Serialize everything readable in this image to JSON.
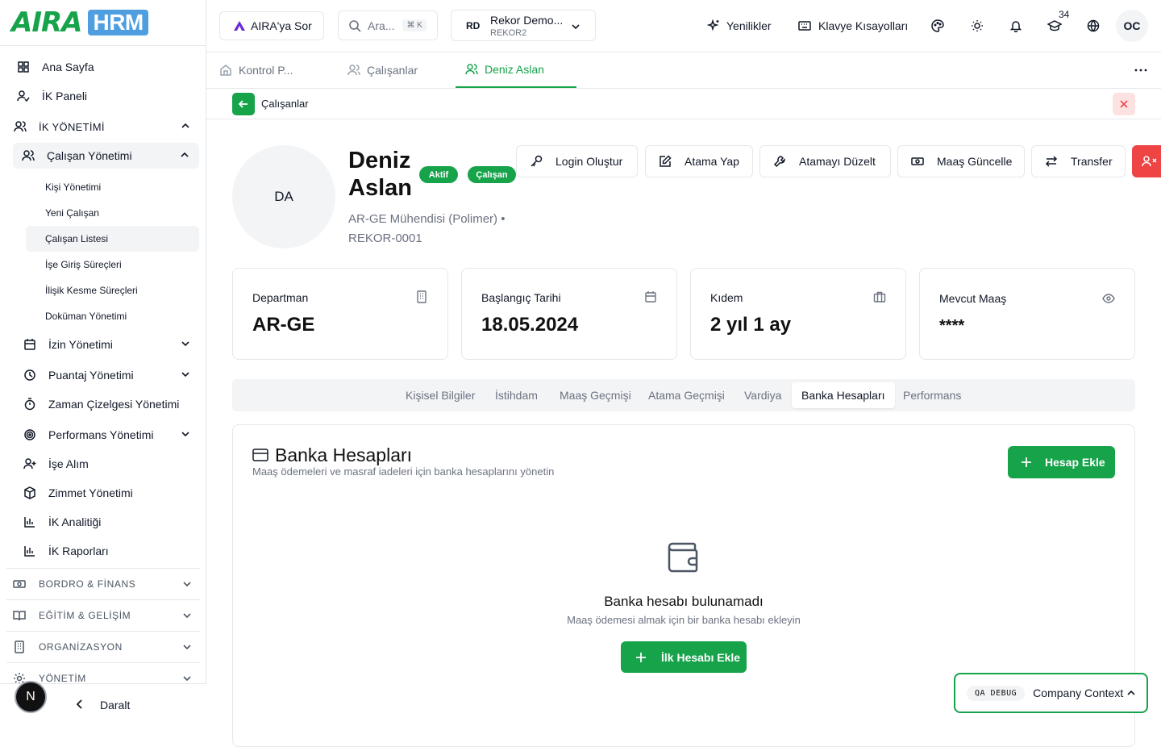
{
  "brand": {
    "logo_text": "AIRA",
    "logo_badge": "HRM",
    "accent": "#16a34a",
    "danger": "#ef4444"
  },
  "sidebar": {
    "items": [
      {
        "label": "Ana Sayfa",
        "icon": "grid-icon"
      },
      {
        "label": "İK Paneli",
        "icon": "user-check-icon"
      }
    ],
    "ik_section": {
      "label": "İK YÖNETİMİ"
    },
    "calisan_yonetimi": {
      "label": "Çalışan Yönetimi",
      "children": [
        "Kişi Yönetimi",
        "Yeni Çalışan",
        "Çalışan Listesi",
        "İşe Giriş Süreçleri",
        "İlişik Kesme Süreçleri",
        "Doküman Yönetimi"
      ]
    },
    "modules": [
      {
        "label": "İzin Yönetimi",
        "icon": "calendar-icon"
      },
      {
        "label": "Puantaj Yönetimi",
        "icon": "clock-icon"
      },
      {
        "label": "Zaman Çizelgesi Yönetimi",
        "icon": "timer-icon"
      },
      {
        "label": "Performans Yönetimi",
        "icon": "target-icon"
      },
      {
        "label": "İşe Alım",
        "icon": "user-plus-icon"
      },
      {
        "label": "Zimmet Yönetimi",
        "icon": "box-icon"
      },
      {
        "label": "İK Analitiği",
        "icon": "bar-chart-icon"
      },
      {
        "label": "İK Raporları",
        "icon": "bar-chart-icon"
      }
    ],
    "sections": [
      {
        "label": "BORDRO & FİNANS",
        "icon": "banknote-icon"
      },
      {
        "label": "EĞİTİM & GELİŞİM",
        "icon": "book-icon"
      },
      {
        "label": "ORGANİZASYON",
        "icon": "building-icon"
      },
      {
        "label": "YÖNETİM",
        "icon": "gear-icon"
      }
    ],
    "collapse_label": "Daralt",
    "user_initial": "N"
  },
  "topbar": {
    "ask_label": "AIRA'ya Sor",
    "search_placeholder": "Ara...",
    "search_shortcut": "⌘ K",
    "company": {
      "initials": "RD",
      "name": "Rekor Demo...",
      "code": "REKOR2"
    },
    "whats_new": "Yenilikler",
    "shortcuts": "Klavye Kısayolları",
    "notification_count": "34",
    "user_initials": "OC"
  },
  "page_tabs": [
    {
      "label": "Kontrol P...",
      "active": false
    },
    {
      "label": "Çalışanlar",
      "active": false
    },
    {
      "label": "Deniz Aslan",
      "active": true
    }
  ],
  "breadcrumb": {
    "label": "Çalışanlar"
  },
  "employee": {
    "initials": "DA",
    "name": "Deniz Aslan",
    "status_badge": "Aktif",
    "type_badge": "Çalışan",
    "title_line": "AR-GE Mühendisi (Polimer) •",
    "code": "REKOR-0001"
  },
  "actions": [
    "Login Oluştur",
    "Atama Yap",
    "Atamayı Düzelt",
    "Maaş Güncelle",
    "Transfer"
  ],
  "stats": [
    {
      "label": "Departman",
      "value": "AR-GE",
      "icon": "building-icon"
    },
    {
      "label": "Başlangıç Tarihi",
      "value": "18.05.2024",
      "icon": "calendar-icon"
    },
    {
      "label": "Kıdem",
      "value": "2 yıl 1 ay",
      "icon": "briefcase-icon"
    },
    {
      "label": "Mevcut Maaş",
      "value": "****",
      "icon": "eye-icon"
    }
  ],
  "sub_tabs": [
    {
      "label": "Kişisel Bilgiler",
      "active": false
    },
    {
      "label": "İstihdam",
      "active": false
    },
    {
      "label": "Maaş Geçmişi",
      "active": false
    },
    {
      "label": "Atama Geçmişi",
      "active": false
    },
    {
      "label": "Vardiya",
      "active": false
    },
    {
      "label": "Banka Hesapları",
      "active": true
    },
    {
      "label": "Performans",
      "active": false
    }
  ],
  "bank_panel": {
    "title": "Banka Hesapları",
    "description": "Maaş ödemeleri ve masraf iadeleri için banka hesaplarını yönetin",
    "add_button": "Hesap Ekle",
    "empty_title": "Banka hesabı bulunamadı",
    "empty_desc": "Maaş ödemesi almak için bir banka hesabı ekleyin",
    "empty_button": "İlk Hesabı Ekle"
  },
  "debug": {
    "pill": "QA DEBUG",
    "label": "Company Context"
  }
}
